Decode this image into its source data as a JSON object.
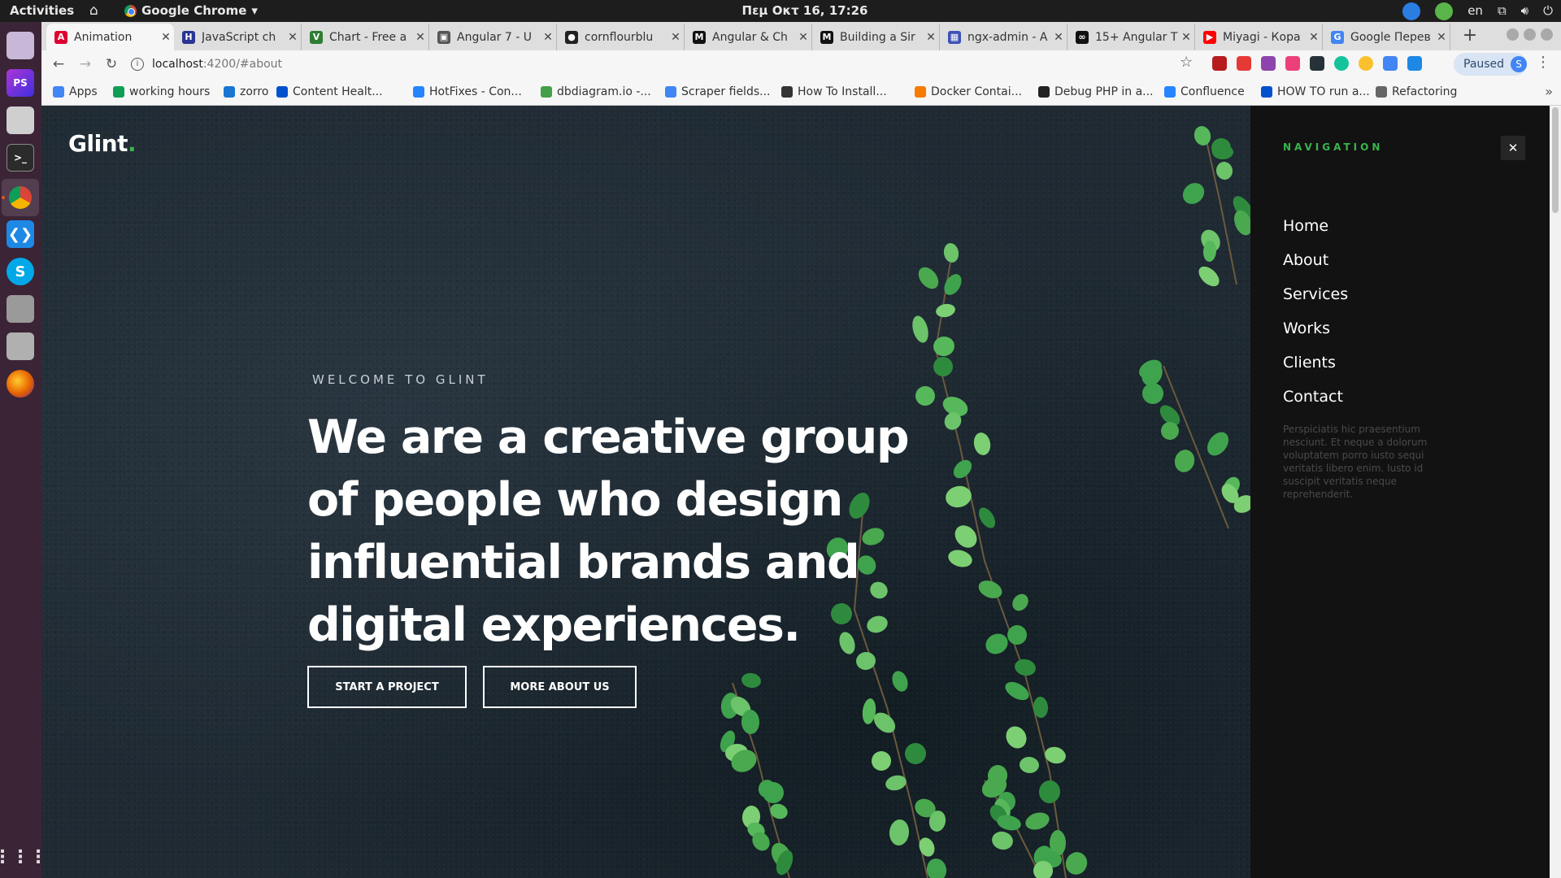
{
  "system": {
    "activities": "Activities",
    "app_menu": "Google Chrome",
    "clock": "Πεμ Οκτ 16, 17:26",
    "language": "en"
  },
  "dock": {
    "items": [
      "phpstorm-icon",
      "files-icon",
      "terminal-icon",
      "chrome-icon",
      "vscode-icon",
      "skype-icon",
      "image-viewer-icon",
      "printer-icon",
      "firefox-icon",
      "app-grid-icon"
    ]
  },
  "tabs": [
    {
      "title": "Animation",
      "color": "#dd0031",
      "glyph": "A"
    },
    {
      "title": "JavaScript ch",
      "color": "#283593",
      "glyph": "H"
    },
    {
      "title": "Chart - Free a",
      "color": "#2e7d32",
      "glyph": "V"
    },
    {
      "title": "Angular 7 - U",
      "color": "#555555",
      "glyph": "▣"
    },
    {
      "title": "cornflourblu",
      "color": "#222222",
      "glyph": "●"
    },
    {
      "title": "Angular & Ch",
      "color": "#111111",
      "glyph": "M"
    },
    {
      "title": "Building a Sir",
      "color": "#111111",
      "glyph": "M"
    },
    {
      "title": "ngx-admin - A",
      "color": "#3f51b5",
      "glyph": "▦"
    },
    {
      "title": "15+ Angular T",
      "color": "#111111",
      "glyph": "∞"
    },
    {
      "title": "Miyagi - Кора",
      "color": "#ff0000",
      "glyph": "▶"
    },
    {
      "title": "Google Перев",
      "color": "#4285f4",
      "glyph": "G"
    }
  ],
  "url": {
    "host": "localhost",
    "path": ":4200/#about"
  },
  "profile": {
    "status": "Paused",
    "initial": "S"
  },
  "bookmarks": [
    {
      "label": "Apps",
      "color": "#4285f4"
    },
    {
      "label": "working hours",
      "color": "#0f9d58"
    },
    {
      "label": "zorro",
      "color": "#1976d2"
    },
    {
      "label": "Content Healt...",
      "color": "#0052cc"
    },
    {
      "label": "HotFixes - Con...",
      "color": "#2684ff"
    },
    {
      "label": "dbdiagram.io -...",
      "color": "#43a047"
    },
    {
      "label": "Scraper fields...",
      "color": "#4285f4"
    },
    {
      "label": "How To Install...",
      "color": "#333333"
    },
    {
      "label": "Docker Contai...",
      "color": "#f57c00"
    },
    {
      "label": "Debug PHP in a...",
      "color": "#222222"
    },
    {
      "label": "Confluence",
      "color": "#2684ff"
    },
    {
      "label": "HOW TO run a...",
      "color": "#0052cc"
    },
    {
      "label": "Refactoring",
      "color": "#666666"
    }
  ],
  "page": {
    "logo": "Glint",
    "logo_dot": ".",
    "welcome": "WELCOME TO GLINT",
    "headline": "We are a creative group of people who design influential brands and digital experiences.",
    "btn_start": "START A PROJECT",
    "btn_about": "MORE ABOUT US",
    "accent_color": "#39b54a"
  },
  "nav": {
    "heading": "NAVIGATION",
    "close": "✕",
    "items": [
      "Home",
      "About",
      "Services",
      "Works",
      "Clients",
      "Contact"
    ],
    "text": "Perspiciatis hic praesentium nesciunt. Et neque a dolorum voluptatem porro iusto sequi veritatis libero enim. Iusto id suscipit veritatis neque reprehenderit."
  }
}
